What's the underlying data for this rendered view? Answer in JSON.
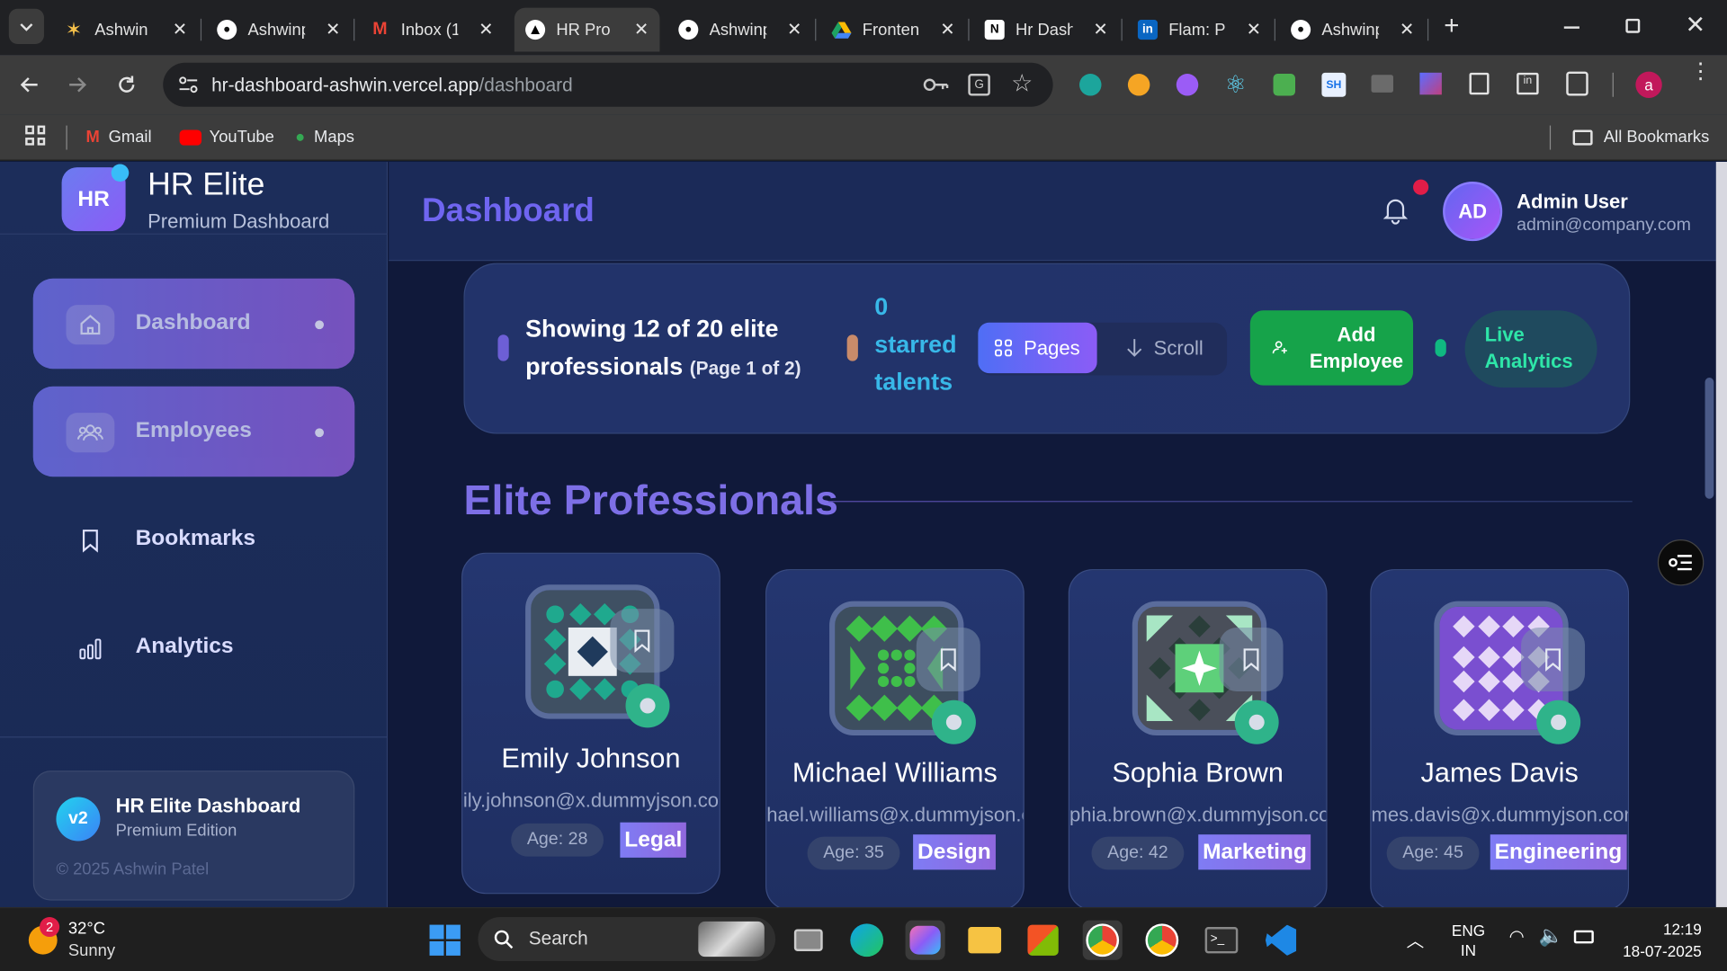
{
  "browser": {
    "tabs": [
      {
        "title": "Ashwin |",
        "close": "✕",
        "icon": "star-icon"
      },
      {
        "title": "Ashwinp",
        "close": "✕",
        "icon": "github-icon"
      },
      {
        "title": "Inbox (1",
        "close": "✕",
        "icon": "gmail-icon"
      },
      {
        "title": "HR Pro |",
        "close": "✕",
        "icon": "vercel-icon"
      },
      {
        "title": "Ashwinp",
        "close": "✕",
        "icon": "github-icon"
      },
      {
        "title": "Fronten",
        "close": "✕",
        "icon": "drive-icon"
      },
      {
        "title": "Hr Dash",
        "close": "✕",
        "icon": "notion-icon"
      },
      {
        "title": "Flam: Pe",
        "close": "✕",
        "icon": "linkedin-icon"
      },
      {
        "title": "Ashwinp",
        "close": "✕",
        "icon": "github-icon"
      }
    ],
    "url_domain": "hr-dashboard-ashwin.vercel.app",
    "url_path": "/dashboard",
    "profile_initial": "a",
    "bookmarks": {
      "gmail": "Gmail",
      "youtube": "YouTube",
      "maps": "Maps",
      "all": "All Bookmarks"
    }
  },
  "sidebar": {
    "logo": "HR",
    "app_name": "HR Elite",
    "app_subtitle": "Premium Dashboard",
    "items": [
      {
        "label": "Dashboard",
        "icon": "home-icon",
        "active": true
      },
      {
        "label": "Employees",
        "icon": "users-icon",
        "active": true
      },
      {
        "label": "Bookmarks",
        "icon": "bookmark-icon",
        "active": false
      },
      {
        "label": "Analytics",
        "icon": "bar-chart-icon",
        "active": false
      }
    ],
    "footer": {
      "badge": "v2",
      "title": "HR Elite Dashboard",
      "subtitle": "Premium Edition",
      "copyright": "© 2025 Ashwin Patel"
    }
  },
  "header": {
    "title": "Dashboard",
    "user_initials": "AD",
    "user_name": "Admin User",
    "user_email": "admin@company.com"
  },
  "stats": {
    "showing": "Showing 12 of 20 elite professionals",
    "showing_line1": "Showing 12 of 20 elite",
    "showing_line2": "professionals",
    "page_info": "(Page 1 of 2)",
    "starred_count": "0",
    "starred_line2": "starred",
    "starred_line3": "talents",
    "pages_label": "Pages",
    "scroll_label": "Scroll",
    "add_line1": "Add",
    "add_line2": "Employee",
    "live_line1": "Live",
    "live_line2": "Analytics"
  },
  "section_title": "Elite Professionals",
  "employees": [
    {
      "name": "Emily Johnson",
      "email": "emily.johnson@x.dummyjson.com",
      "email_shown": "ily.johnson@x.dummyjson.co",
      "age": "Age: 28",
      "department": "Legal"
    },
    {
      "name": "Michael Williams",
      "email": "michael.williams@x.dummyjson.com",
      "email_shown": "hael.williams@x.dummyjson.c",
      "age": "Age: 35",
      "department": "Design"
    },
    {
      "name": "Sophia Brown",
      "email": "sophia.brown@x.dummyjson.com",
      "email_shown": "phia.brown@x.dummyjson.co",
      "age": "Age: 42",
      "department": "Marketing"
    },
    {
      "name": "James Davis",
      "email": "james.davis@x.dummyjson.com",
      "email_shown": "mes.davis@x.dummyjson.con",
      "age": "Age: 45",
      "department": "Engineering"
    }
  ],
  "taskbar": {
    "weather_badge": "2",
    "temperature": "32°C",
    "weather": "Sunny",
    "search": "Search",
    "lang1": "ENG",
    "lang2": "IN",
    "time": "12:19",
    "date": "18-07-2025"
  },
  "colors": {
    "accent": "#6f65f0",
    "green": "#16a34a",
    "teal": "#2fb38a",
    "bg": "#10193a"
  }
}
